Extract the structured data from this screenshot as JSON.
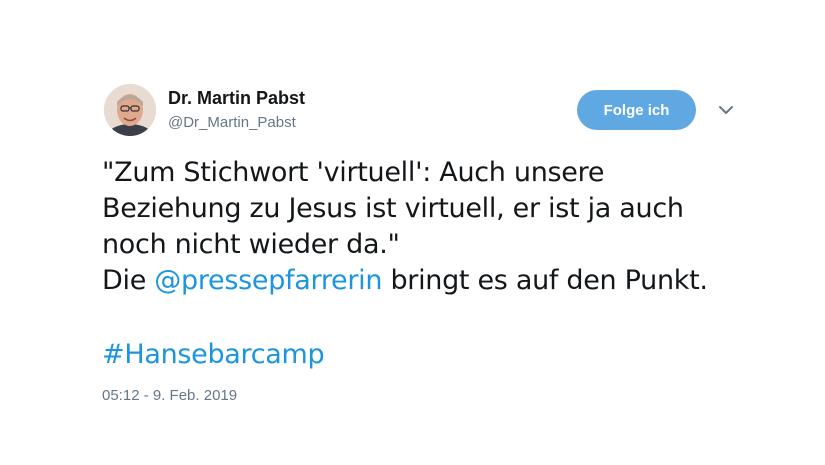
{
  "author": {
    "display_name": "Dr. Martin Pabst",
    "handle": "@Dr_Martin_Pabst",
    "avatar_icon": "profile-photo"
  },
  "actions": {
    "follow_label": "Folge ich",
    "menu_icon": "chevron-down-icon"
  },
  "tweet": {
    "line1": "\"Zum Stichwort 'virtuell': Auch unsere",
    "line2": "Beziehung zu Jesus ist virtuell, er ist ja auch",
    "line3": "noch nicht wieder da.\"",
    "line4_prefix": "Die ",
    "mention": "@pressepfarrerin",
    "line4_suffix": " bringt es auf den Punkt.",
    "hashtag": "#Hansebarcamp"
  },
  "timestamp": "05:12 - 9. Feb. 2019",
  "colors": {
    "link": "#1b95e0",
    "follow_button": "#5fa8e1",
    "secondary_text": "#657786",
    "primary_text": "#14171a"
  }
}
